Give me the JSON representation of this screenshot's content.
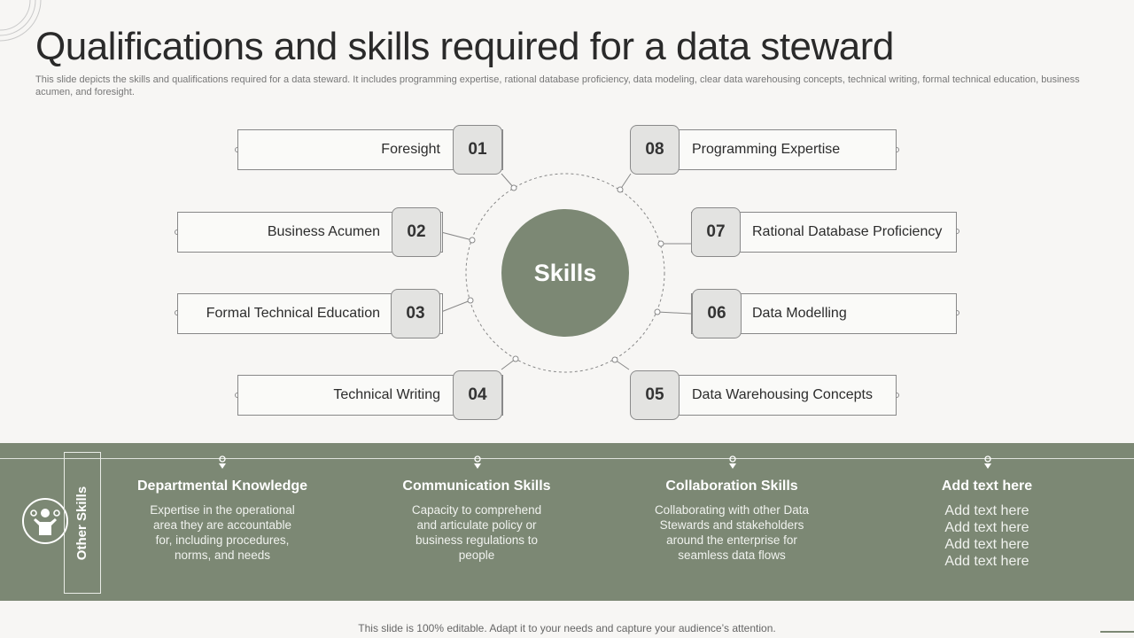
{
  "title": "Qualifications and skills required for a data steward",
  "subtitle": "This slide depicts the skills and qualifications required for a data steward. It includes programming expertise, rational database proficiency, data modeling, clear data warehousing concepts, technical writing, formal technical education, business acumen, and foresight.",
  "center_label": "Skills",
  "skills": [
    {
      "num": "01",
      "label": "Foresight"
    },
    {
      "num": "02",
      "label": "Business Acumen"
    },
    {
      "num": "03",
      "label": "Formal Technical Education"
    },
    {
      "num": "04",
      "label": "Technical Writing"
    },
    {
      "num": "05",
      "label": "Data Warehousing Concepts"
    },
    {
      "num": "06",
      "label": "Data Modelling"
    },
    {
      "num": "07",
      "label": "Rational Database Proficiency"
    },
    {
      "num": "08",
      "label": "Programming Expertise"
    }
  ],
  "other_skills": {
    "label": "Other Skills",
    "icon": "person-with-gears-icon",
    "items": [
      {
        "title": "Departmental Knowledge",
        "text": "Expertise in the operational area they are accountable for, including procedures, norms, and needs"
      },
      {
        "title": "Communication Skills",
        "text": "Capacity to comprehend and articulate policy or business regulations to people"
      },
      {
        "title": "Collaboration Skills",
        "text": "Collaborating with other Data Stewards and stakeholders around the enterprise for seamless data flows"
      },
      {
        "title": "Add text here",
        "lines": [
          "Add text here",
          "Add text here",
          "Add text here",
          "Add text here"
        ]
      }
    ]
  },
  "footer": "This slide is 100% editable. Adapt it to your needs and capture your audience’s attention.",
  "colors": {
    "accent": "#7c8874",
    "number_box": "#e3e3e1",
    "background": "#f7f6f4"
  }
}
